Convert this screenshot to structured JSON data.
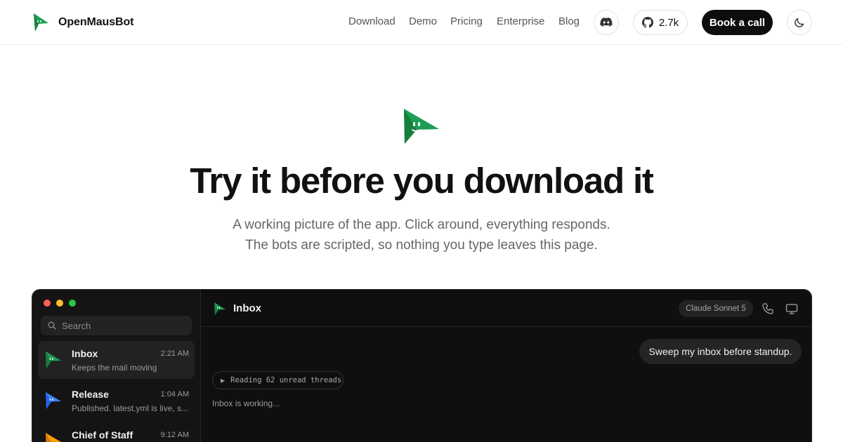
{
  "header": {
    "brand_name": "OpenMausBot",
    "nav": [
      {
        "label": "Download"
      },
      {
        "label": "Demo"
      },
      {
        "label": "Pricing"
      },
      {
        "label": "Enterprise"
      },
      {
        "label": "Blog"
      }
    ],
    "github_stars": "2.7k",
    "book_call_label": "Book a call",
    "icons": {
      "discord": "discord-icon",
      "github": "github-icon",
      "theme": "moon-icon"
    }
  },
  "hero": {
    "title": "Try it before you download it",
    "subtitle_line1": "A working picture of the app. Click around, everything responds.",
    "subtitle_line2": "The bots are scripted, so nothing you type leaves this page."
  },
  "app": {
    "search_placeholder": "Search",
    "threads": [
      {
        "name": "Inbox",
        "time": "2:21 AM",
        "preview": "Keeps the mail moving",
        "color": "#1f9d55",
        "active": true
      },
      {
        "name": "Release",
        "time": "1:04 AM",
        "preview": "Published. latest.yml is live, s...",
        "color": "#3b82f6",
        "active": false
      },
      {
        "name": "Chief of Staff",
        "time": "9:12 AM",
        "preview": "",
        "color": "#f59e0b",
        "active": false
      }
    ],
    "chat": {
      "title": "Inbox",
      "model": "Claude Sonnet 5",
      "user_message": "Sweep my inbox before standup.",
      "tool_status": "Reading 62 unread threads",
      "working_status": "Inbox is working..."
    }
  },
  "colors": {
    "brand_green": "#1f9d55",
    "dark_bg": "#0f0f10",
    "button_dark": "#0d0d0d"
  }
}
